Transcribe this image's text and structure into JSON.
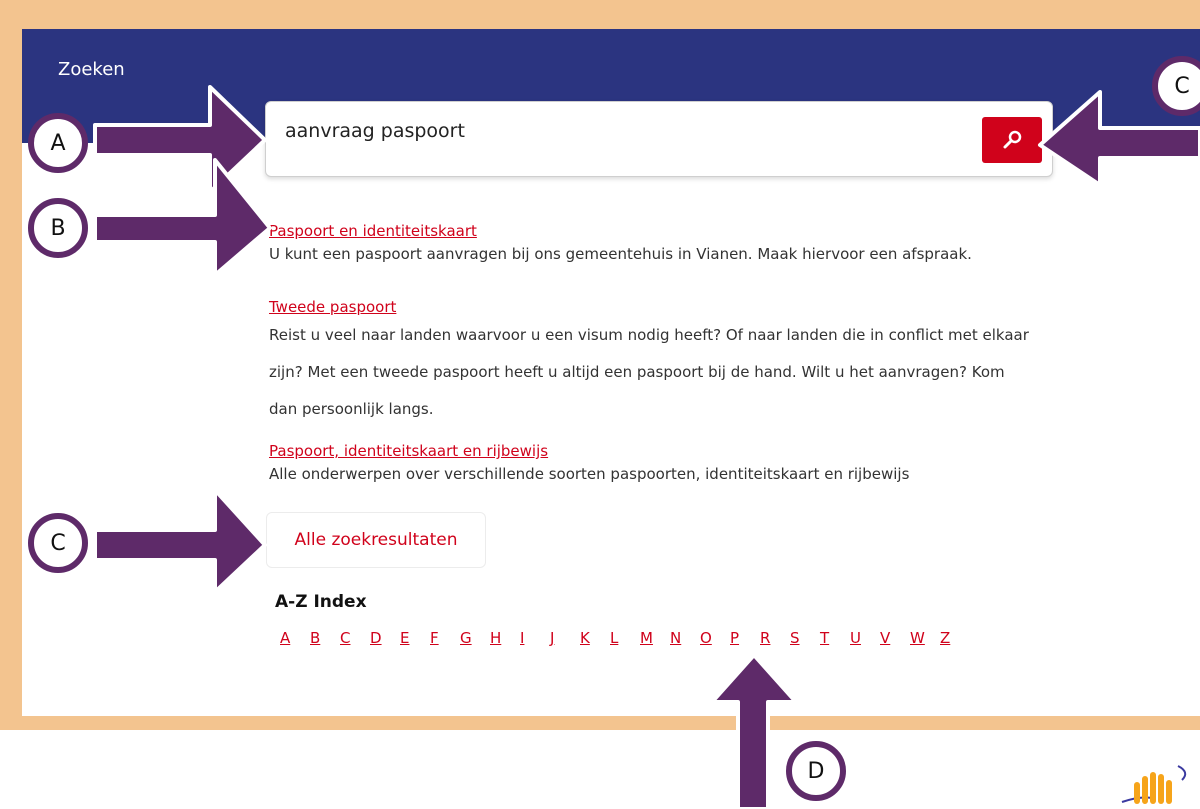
{
  "header": {
    "title": "Zoeken"
  },
  "search": {
    "value": "aanvraag paspoort",
    "button_icon": "search-icon"
  },
  "results": [
    {
      "title": "Paspoort en identiteitskaart",
      "description": "U kunt een paspoort aanvragen bij ons gemeentehuis in Vianen. Maak hiervoor een afspraak."
    },
    {
      "title": "Tweede paspoort",
      "description": "Reist u veel naar landen waarvoor u een visum nodig heeft? Of naar landen die in conflict met elkaar zijn? Met een tweede paspoort heeft u altijd een paspoort bij de hand. Wilt u het aanvragen? Kom dan persoonlijk langs."
    },
    {
      "title": "Paspoort, identiteitskaart en rijbewijs",
      "description": "Alle onderwerpen over verschillende soorten paspoorten, identiteitskaart en rijbewijs"
    }
  ],
  "all_results_label": "Alle zoekresultaten",
  "az_index": {
    "title": "A-Z Index",
    "letters": [
      "A",
      "B",
      "C",
      "D",
      "E",
      "F",
      "G",
      "H",
      "I",
      "J",
      "K",
      "L",
      "M",
      "N",
      "O",
      "P",
      "R",
      "S",
      "T",
      "U",
      "V",
      "W",
      "Z"
    ]
  },
  "annotations": {
    "a": "A",
    "b": "B",
    "c1": "C",
    "c2": "C",
    "d": "D"
  },
  "colors": {
    "frame": "#f3c48f",
    "header": "#2b3480",
    "accent": "#d0021b",
    "arrow": "#5e2a69"
  }
}
